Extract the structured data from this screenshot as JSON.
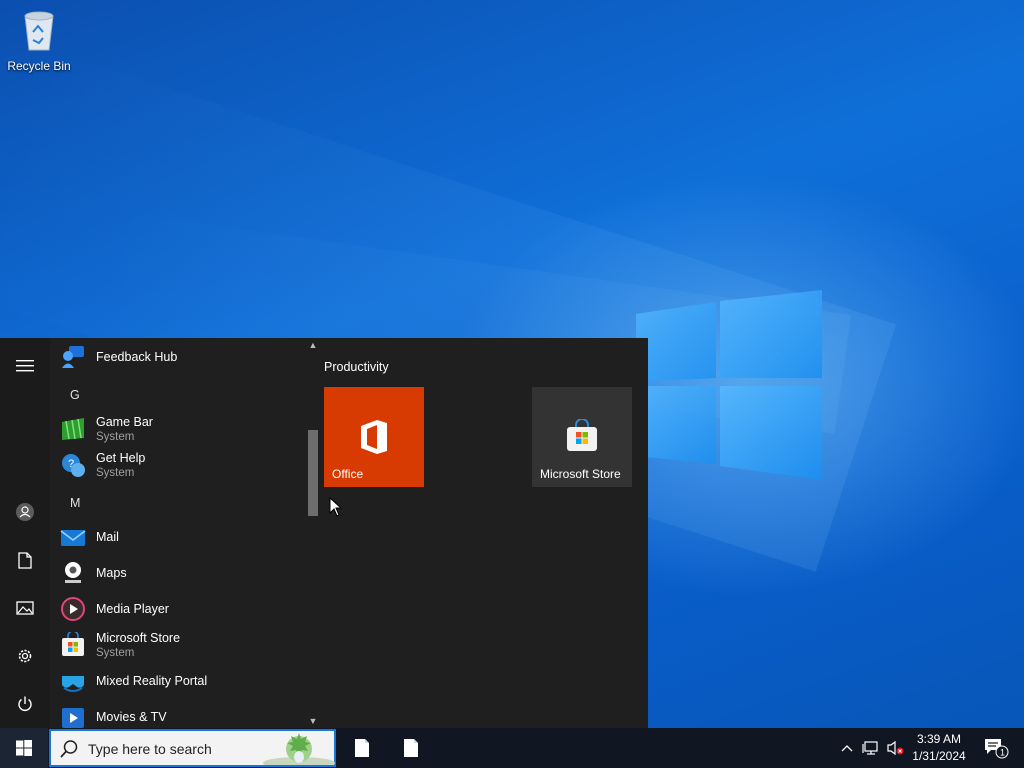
{
  "desktop": {
    "icons": [
      {
        "label": "Recycle Bin",
        "icon": "recycle-bin-icon"
      }
    ]
  },
  "start_menu": {
    "rail": {
      "items": [
        {
          "name": "hamburger-menu-icon"
        },
        {
          "name": "user-account-icon"
        },
        {
          "name": "documents-icon"
        },
        {
          "name": "pictures-icon"
        },
        {
          "name": "settings-gear-icon"
        },
        {
          "name": "power-icon"
        }
      ]
    },
    "app_list": {
      "items": [
        {
          "type": "app",
          "name": "Feedback Hub",
          "icon": "feedback-hub-icon"
        },
        {
          "type": "letter",
          "name": "G"
        },
        {
          "type": "app",
          "name": "Game Bar",
          "sub": "System",
          "icon": "game-bar-icon"
        },
        {
          "type": "app",
          "name": "Get Help",
          "sub": "System",
          "icon": "get-help-icon"
        },
        {
          "type": "letter",
          "name": "M"
        },
        {
          "type": "app",
          "name": "Mail",
          "icon": "mail-icon"
        },
        {
          "type": "app",
          "name": "Maps",
          "icon": "maps-icon"
        },
        {
          "type": "app",
          "name": "Media Player",
          "icon": "media-player-icon"
        },
        {
          "type": "app",
          "name": "Microsoft Store",
          "sub": "System",
          "icon": "microsoft-store-icon"
        },
        {
          "type": "app",
          "name": "Mixed Reality Portal",
          "icon": "mixed-reality-portal-icon"
        },
        {
          "type": "app",
          "name": "Movies & TV",
          "icon": "movies-tv-icon"
        }
      ]
    },
    "tiles": {
      "group_title": "Productivity",
      "items": [
        {
          "label": "Office",
          "color": "#d83b01",
          "icon": "office-icon"
        },
        {
          "label": "Microsoft Store",
          "color": "#333333",
          "icon": "microsoft-store-icon"
        }
      ]
    }
  },
  "taskbar": {
    "search_placeholder": "Type here to search",
    "pinned": [
      {
        "icon": "document-icon"
      },
      {
        "icon": "document-icon"
      }
    ],
    "tray": {
      "icons": [
        "chevron-up-icon",
        "network-icon",
        "volume-muted-icon"
      ],
      "time": "3:39 AM",
      "date": "1/31/2024",
      "notification_count": "1"
    }
  },
  "colors": {
    "accent": "#0078d7",
    "start_bg": "#1f1f1f",
    "taskbar_bg": "#101722",
    "office_tile": "#d83b01",
    "store_tile": "#333333"
  }
}
